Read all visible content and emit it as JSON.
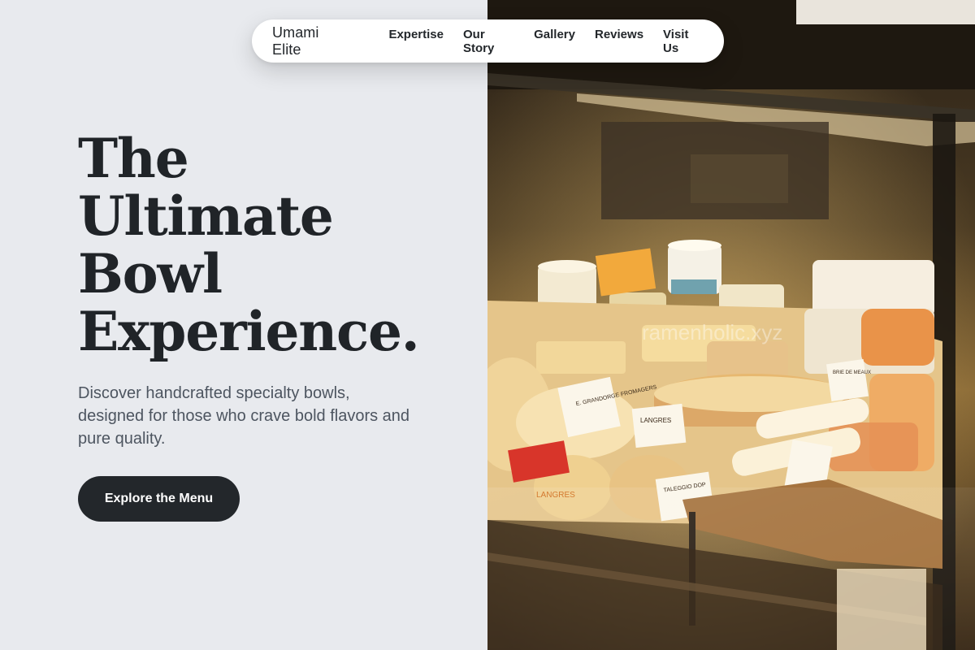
{
  "nav": {
    "brand": "Umami Elite",
    "links": [
      "Expertise",
      "Our Story",
      "Gallery",
      "Reviews",
      "Visit Us"
    ]
  },
  "hero": {
    "headline_lines": [
      "The",
      "Ultimate",
      "Bowl",
      "Experience."
    ],
    "subtitle": "Discover handcrafted specialty bowls, designed for those who crave bold flavors and pure quality.",
    "cta_label": "Explore the Menu"
  },
  "photo": {
    "description_icon": "cheese-display-photo",
    "watermark": "ramenholic.xyz",
    "labels": [
      "LANGRES",
      "E. GRANDORGE FROMAGERS",
      "LANGRES",
      "TALEGGIO DOP",
      "BRIE DE MEAUX"
    ]
  },
  "colors": {
    "background_left": "#e8eaee",
    "text_dark": "#202428",
    "text_muted": "#4d5560",
    "button_bg": "#23272b",
    "nav_bg": "#ffffff"
  }
}
